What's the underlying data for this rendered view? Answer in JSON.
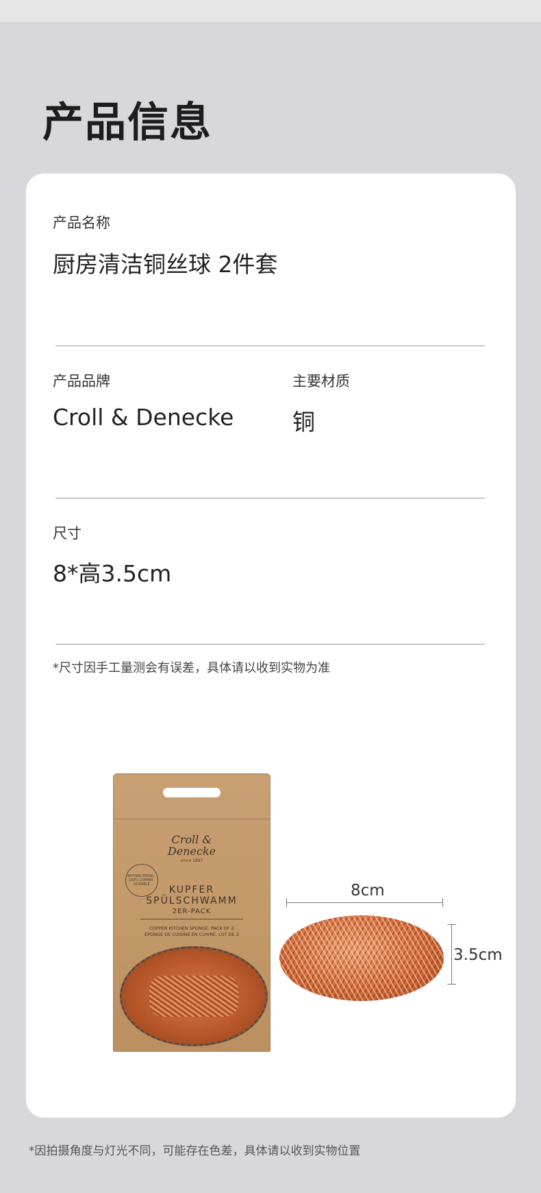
{
  "page": {
    "title": "产品信息"
  },
  "name": {
    "label": "产品名称",
    "value": "厨房清洁铜丝球 2件套"
  },
  "brand": {
    "label": "产品品牌",
    "value": "Croll & Denecke"
  },
  "material": {
    "label": "主要材质",
    "value": "铜"
  },
  "size": {
    "label": "尺寸",
    "value": "8*高3.5cm",
    "note": "*尺寸因手工量测会有误差，具体请以收到实物为准"
  },
  "package": {
    "brand_line1": "Croll &",
    "brand_line2": "Denecke",
    "since": "since 1897",
    "badge": "ANTIBACTERIAL · 100% COPPER · DURABLE",
    "line1": "KUPFER",
    "line2": "SPÜLSCHWAMM",
    "line3": "2ER-PACK",
    "small1": "COPPER KITCHEN SPONGE, PACK OF 2",
    "small2": "ÉPONGE DE CUISINE EN CUIVRE, LOT DE 2"
  },
  "dimensions": {
    "width_label": "8cm",
    "height_label": "3.5cm"
  },
  "footer": {
    "note": "*因拍摄角度与灯光不同，可能存在色差，具体请以收到实物位置"
  }
}
